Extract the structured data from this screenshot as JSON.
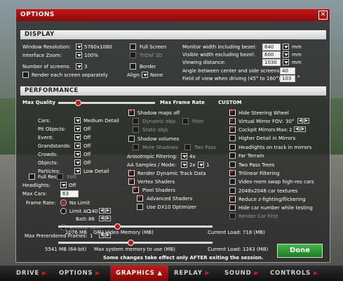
{
  "window": {
    "title": "OPTIONS"
  },
  "sections": {
    "display": "DISPLAY",
    "performance": "PERFORMANCE"
  },
  "display": {
    "window_resolution_label": "Window Resolution:",
    "window_resolution_value": "5760x1080",
    "interface_zoom_label": "Interface Zoom:",
    "interface_zoom_value": "100%",
    "number_of_screens_label": "Number of screens:",
    "number_of_screens_value": "3",
    "render_each_screen_label": "Render each screen separately",
    "full_screen_label": "Full Screen",
    "trideef_label": "TriDef 3D",
    "border_label": "Border",
    "align_label": "Align:",
    "align_value": "None",
    "monitor_width_label": "Monitor width including bezel:",
    "monitor_width_value": "640",
    "visible_width_label": "Visible width excluding bezel:",
    "visible_width_value": "600",
    "viewing_distance_label": "Viewing distance:",
    "viewing_distance_value": "1030",
    "angle_label": "Angle between center and side screens:",
    "angle_value": "40",
    "fov_label": "Field of view when driving (45° to 160°):",
    "fov_value": "103",
    "mm_unit": "mm",
    "deg_unit": "°"
  },
  "performance": {
    "max_quality_label": "Max Quality",
    "max_frame_rate_label": "Max Frame Rate",
    "custom_label": "CUSTOM",
    "rows": [
      {
        "label": "Cars:",
        "value": "Medium Detail"
      },
      {
        "label": "Pit Objects:",
        "value": "Off"
      },
      {
        "label": "Event:",
        "value": "Off"
      },
      {
        "label": "Grandstands:",
        "value": "Off"
      },
      {
        "label": "Crowds:",
        "value": "Off"
      },
      {
        "label": "Objects:",
        "value": "Off"
      },
      {
        "label": "Particles:",
        "value": "Low Detail"
      }
    ],
    "full_res_label": "Full Res",
    "soft_label": "Soft",
    "headlights_label": "Headlights:",
    "headlights_value": "Off",
    "max_cars_label": "Max Cars:",
    "max_cars_value": "63",
    "frame_rate_label": "Frame Rate:",
    "no_limit_label": "No Limit",
    "limit_ac_label": "Limit AC:",
    "limit_ac_value": "140",
    "batt_label": "Batt:",
    "batt_value": "86",
    "vertical_sync_label": "Vertical Sync",
    "prerendered_label": "Max Prerendered Frames:",
    "prerendered_value": "1",
    "shadow_maps_off": "Shadow maps off",
    "dynamic_objs": "Dynamic objs",
    "filter": "filter",
    "static_objs": "Static objs",
    "shadow_volumes": "Shadow volumes",
    "more_shadows": "More Shadows",
    "two_pass": "Two Pass",
    "aniso_label": "Anisotropic Filtering:",
    "aniso_value": "4x",
    "aa_label": "AA Samples / Mode:",
    "aa_samples": "2x",
    "aa_mode": "1",
    "render_dynamic_track": "Render Dynamic Track Data",
    "vertex_shaders": "Vertex Shaders",
    "pixel_shaders": "Pixel Shaders",
    "advanced_shaders": "Advanced Shaders",
    "use_dx10": "Use DX10 Optimizer",
    "hide_steering_wheel": "Hide Steering Wheel",
    "virtual_mirror": "Virtual Mirror",
    "virtual_mirror_fov_label": "FOV:",
    "virtual_mirror_fov_value": "30°",
    "cockpit_mirrors": "Cockpit Mirrors",
    "cockpit_max_label": "Max:",
    "cockpit_max_value": "2",
    "higher_detail_mirrors": "Higher Detail in Mirrors",
    "headlights_on_track": "Headlights on track in mirrors",
    "far_terrain": "Far Terrain",
    "two_pass_trees": "Two Pass Trees",
    "trilinear": "Trilinear Filtering",
    "video_mem_swap": "Video mem swap high-res cars",
    "textures_2048": "2048x2048 car textures",
    "reduce_zfighting": "Reduce z-fighting/flickering",
    "hide_car_number": "Hide car number while testing",
    "render_car_first": "Render Car First",
    "gpu_memory_value": "1076 MB",
    "gpu_memory_label": "GPU Video Memory (MB)",
    "gpu_current_load": "Current Load: 718 (MB)",
    "sys_memory_value": "5541 MB (64-bit)",
    "sys_memory_label": "Max system memory to use (MB)",
    "sys_current_load": "Current Load: 1243 (MB)",
    "gpu_memory_fraction": 0.38,
    "sys_memory_fraction": 0.47,
    "quality_fraction": 0.2
  },
  "footer_note": "Some changes take effect only AFTER exiting the session.",
  "done_label": "Done",
  "bottom_tabs": [
    "DRIVE",
    "OPTIONS",
    "GRAPHICS",
    "REPLAY",
    "SOUND",
    "CONTROLS"
  ],
  "active_tab": "GRAPHICS"
}
